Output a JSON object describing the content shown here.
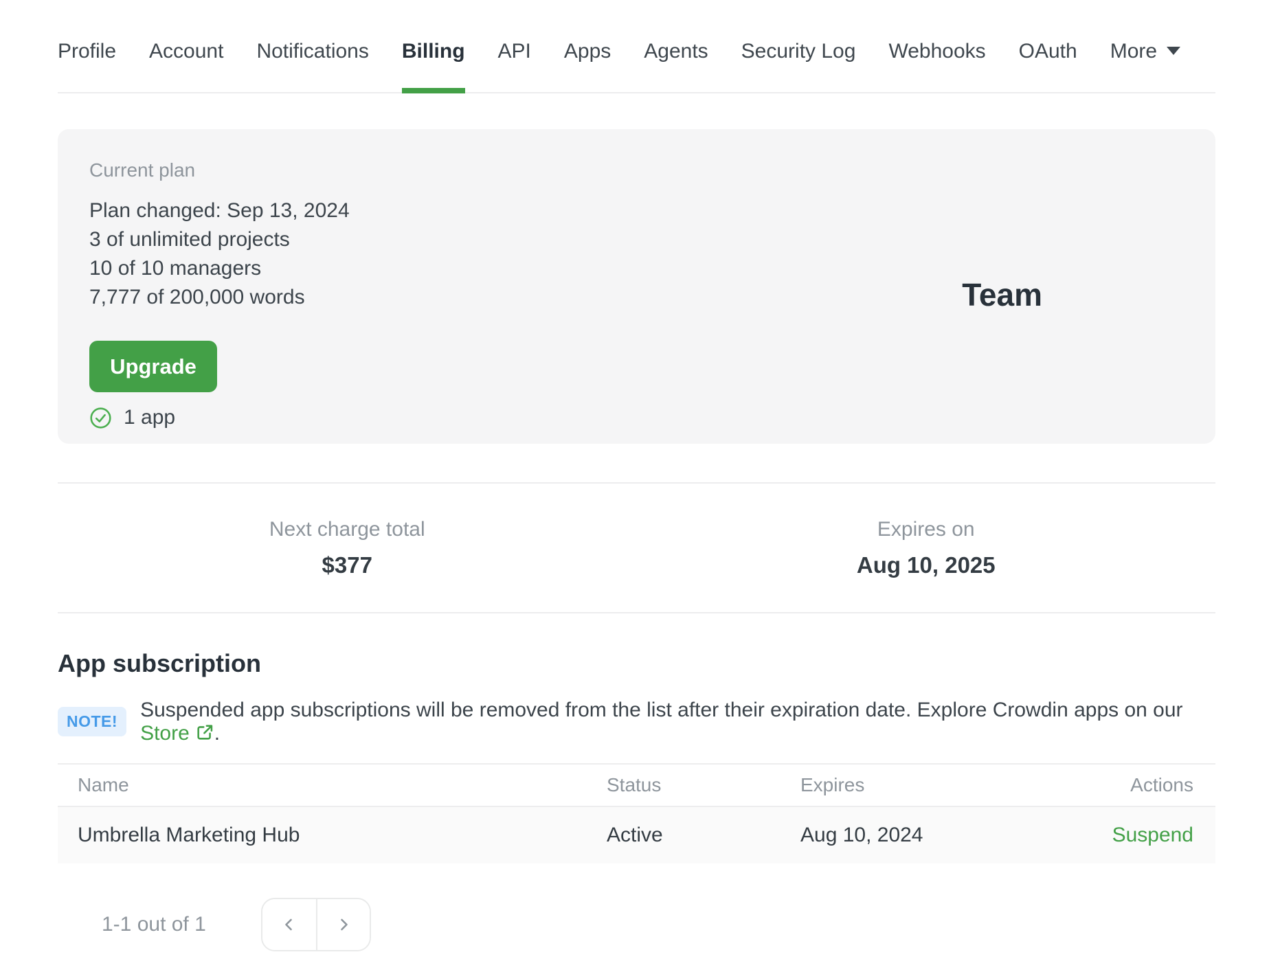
{
  "colors": {
    "accent_green": "#43a047",
    "check_icon_green": "#4caf50",
    "note_badge_bg": "#e4f0fd",
    "note_badge_text": "#459ae8",
    "card_bg": "#f5f5f6",
    "row_bg": "#fafafa"
  },
  "icons": {
    "caret_down": "▾",
    "check_circle": "✓",
    "external_link": "↗",
    "chevron_left": "‹",
    "chevron_right": "›"
  },
  "nav": {
    "active_tab": "Billing",
    "tabs": [
      {
        "label": "Profile"
      },
      {
        "label": "Account"
      },
      {
        "label": "Notifications"
      },
      {
        "label": "Billing"
      },
      {
        "label": "API"
      },
      {
        "label": "Apps"
      },
      {
        "label": "Agents"
      },
      {
        "label": "Security Log"
      },
      {
        "label": "Webhooks"
      },
      {
        "label": "OAuth"
      },
      {
        "label": "More"
      }
    ]
  },
  "plan_card": {
    "label": "Current plan",
    "lines": [
      "Plan changed: Sep 13, 2024",
      "3 of unlimited projects",
      "10 of 10 managers",
      "7,777 of 200,000 words"
    ],
    "upgrade_label": "Upgrade",
    "apps_count": "1 app",
    "plan_name": "Team"
  },
  "billing_summary": {
    "next_charge_label": "Next charge total",
    "next_charge_value": "$377",
    "expires_label": "Expires on",
    "expires_value": "Aug 10, 2025"
  },
  "app_subscription": {
    "title": "App subscription",
    "note_badge": "NOTE!",
    "note_text": "Suspended app subscriptions will be removed from the list after their expiration date. Explore Crowdin apps on our",
    "note_link": "Store",
    "note_suffix": ".",
    "table": {
      "headers": [
        "Name",
        "Status",
        "Expires",
        "Actions"
      ],
      "rows": [
        {
          "name": "Umbrella Marketing Hub",
          "status": "Active",
          "expires": "Aug 10, 2024",
          "action": "Suspend"
        }
      ]
    },
    "pagination": {
      "label": "1-1 out of 1"
    }
  }
}
